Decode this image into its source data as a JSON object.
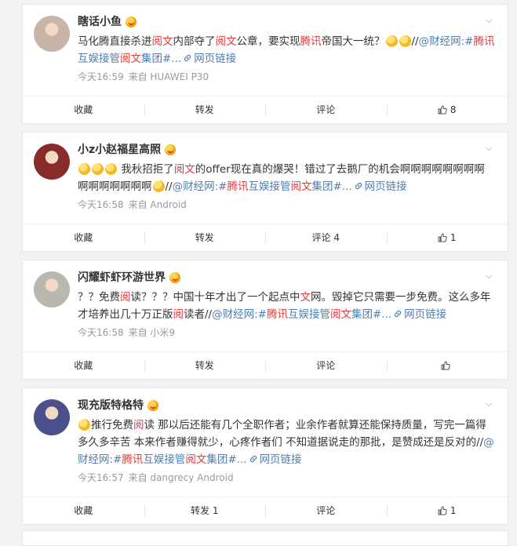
{
  "posts": [
    {
      "name": "瞎话小鱼",
      "text": [
        {
          "t": "马化腾直接杀进",
          "c": "n"
        },
        {
          "t": "阅文",
          "c": "hl"
        },
        {
          "t": "内部夺了",
          "c": "n"
        },
        {
          "t": "阅文",
          "c": "hl"
        },
        {
          "t": "公章，要实现",
          "c": "n"
        },
        {
          "t": "腾讯",
          "c": "hl"
        },
        {
          "t": "帝国大一统？",
          "c": "n"
        },
        {
          "t": "",
          "c": "emo"
        },
        {
          "t": "",
          "c": "emo"
        },
        {
          "t": "//",
          "c": "n"
        },
        {
          "t": "@财经网",
          "c": "lk"
        },
        {
          "t": ":#",
          "c": "lk"
        },
        {
          "t": "腾讯",
          "c": "hl"
        },
        {
          "t": "互娱接管",
          "c": "lk"
        },
        {
          "t": "阅文",
          "c": "hl"
        },
        {
          "t": "集团",
          "c": "lk"
        },
        {
          "t": "#...",
          "c": "lk"
        },
        {
          "t": "",
          "c": "linkicon"
        },
        {
          "t": "网页链接",
          "c": "lk"
        }
      ],
      "time": "今天16:59",
      "source": "来自 HUAWEI P30",
      "actions": {
        "favorite": "收藏",
        "repost": "转发",
        "comment": "评论",
        "like": "8"
      },
      "avatar_color": "#c9b4a8"
    },
    {
      "name": "小z小赵福星高照",
      "text": [
        {
          "t": "",
          "c": "emo"
        },
        {
          "t": "",
          "c": "emo"
        },
        {
          "t": "",
          "c": "emo"
        },
        {
          "t": " 我秋招拒了",
          "c": "n"
        },
        {
          "t": "阅文",
          "c": "hl"
        },
        {
          "t": "的offer现在真的爆哭！错过了去鹅厂的机会啊啊啊啊啊啊啊啊啊啊啊啊啊啊啊",
          "c": "n"
        },
        {
          "t": "",
          "c": "emo"
        },
        {
          "t": "//",
          "c": "n"
        },
        {
          "t": "@财经网",
          "c": "lk"
        },
        {
          "t": ":#",
          "c": "lk"
        },
        {
          "t": "腾讯",
          "c": "hl"
        },
        {
          "t": "互娱接管",
          "c": "lk"
        },
        {
          "t": "阅文",
          "c": "hl"
        },
        {
          "t": "集团",
          "c": "lk"
        },
        {
          "t": "#...",
          "c": "lk"
        },
        {
          "t": "",
          "c": "linkicon"
        },
        {
          "t": "网页链接",
          "c": "lk"
        }
      ],
      "time": "今天16:58",
      "source": "来自 Android",
      "actions": {
        "favorite": "收藏",
        "repost": "转发",
        "comment": "评论 4",
        "like": "1"
      },
      "avatar_color": "#8a2b2b"
    },
    {
      "name": "闪耀虾虾环游世界",
      "text": [
        {
          "t": "？？免费",
          "c": "n"
        },
        {
          "t": "阅",
          "c": "hl"
        },
        {
          "t": "读？？？中国十年才出了一个起点中",
          "c": "n"
        },
        {
          "t": "文",
          "c": "hl"
        },
        {
          "t": "网。毁掉它只需要一步免费。这么多年才培养出几十万正版",
          "c": "n"
        },
        {
          "t": "阅",
          "c": "hl"
        },
        {
          "t": "读者//",
          "c": "n"
        },
        {
          "t": "@财经网",
          "c": "lk"
        },
        {
          "t": ":#",
          "c": "lk"
        },
        {
          "t": "腾讯",
          "c": "hl"
        },
        {
          "t": "互娱接管",
          "c": "lk"
        },
        {
          "t": "阅文",
          "c": "hl"
        },
        {
          "t": "集团",
          "c": "lk"
        },
        {
          "t": "#...",
          "c": "lk"
        },
        {
          "t": "",
          "c": "linkicon"
        },
        {
          "t": "网页链接",
          "c": "lk"
        }
      ],
      "time": "今天16:58",
      "source": "来自 小米9",
      "actions": {
        "favorite": "收藏",
        "repost": "转发",
        "comment": "评论",
        "like": ""
      },
      "avatar_color": "#b8b8b0"
    },
    {
      "name": "现充版特格特",
      "text": [
        {
          "t": "",
          "c": "emo"
        },
        {
          "t": "推行免费",
          "c": "n"
        },
        {
          "t": "阅",
          "c": "hl"
        },
        {
          "t": "读 那以后还能有几个全职作者；业余作者就算还能保持质量，写完一篇得多久多辛苦 本来作者赚得就少，心疼作者们 不知道据说走的那批，是赞成还是反对的//",
          "c": "n"
        },
        {
          "t": "@财经网",
          "c": "lk"
        },
        {
          "t": ":#",
          "c": "lk"
        },
        {
          "t": "腾讯",
          "c": "hl"
        },
        {
          "t": "互娱接管",
          "c": "lk"
        },
        {
          "t": "阅文",
          "c": "hl"
        },
        {
          "t": "集团",
          "c": "lk"
        },
        {
          "t": "#...",
          "c": "lk"
        },
        {
          "t": "",
          "c": "linkicon"
        },
        {
          "t": "网页链接",
          "c": "lk"
        }
      ],
      "time": "今天16:57",
      "source": "来自 dangrecy Android",
      "actions": {
        "favorite": "收藏",
        "repost": "转发 1",
        "comment": "评论",
        "like": "1"
      },
      "avatar_color": "#4b4f8a"
    }
  ],
  "colors": {
    "highlight": "#e4393c",
    "link": "#507daf",
    "meta": "#999999"
  }
}
